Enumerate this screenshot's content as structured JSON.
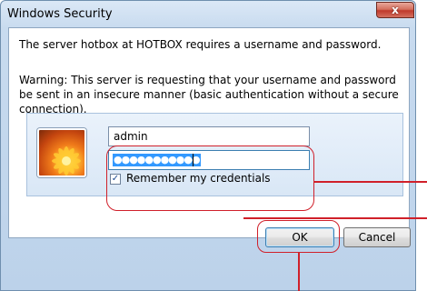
{
  "window": {
    "title": "Windows Security",
    "close_glyph": "x"
  },
  "message": {
    "line1": "The server hotbox at HOTBOX requires a username and password.",
    "warning": "Warning: This server is requesting that your username and password be sent in an insecure manner (basic authentication without a secure connection)."
  },
  "credentials": {
    "avatar_icon": "user-avatar-flower-icon",
    "username_value": "admin",
    "password_masked": "●●●●●●●●●●●",
    "remember_checked_glyph": "✓",
    "remember_label": "Remember my credentials"
  },
  "buttons": {
    "ok_label": "OK",
    "cancel_label": "Cancel"
  },
  "annotation_color": "#d0202a"
}
